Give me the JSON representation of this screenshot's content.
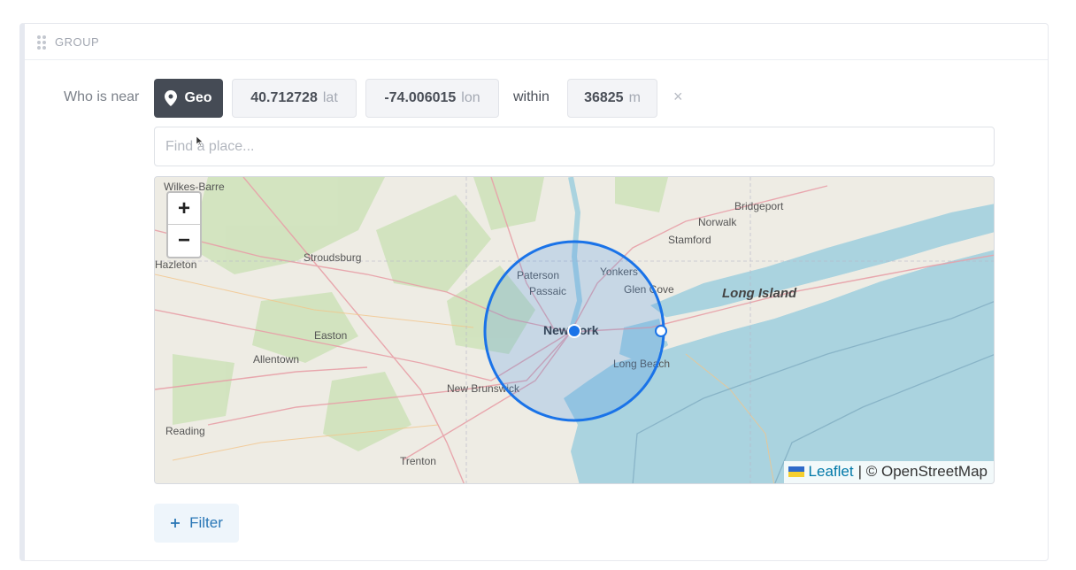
{
  "group": {
    "title": "GROUP"
  },
  "condition": {
    "label": "Who is near",
    "type_label": "Geo",
    "lat_value": "40.712728",
    "lat_unit": "lat",
    "lon_value": "-74.006015",
    "lon_unit": "lon",
    "within_label": "within",
    "radius_value": "36825",
    "radius_unit": "m",
    "remove_label": "×"
  },
  "search": {
    "placeholder": "Find a place..."
  },
  "map": {
    "zoom_in": "+",
    "zoom_out": "−",
    "attribution_link": "Leaflet",
    "attribution_text": "| © OpenStreetMap",
    "labels": {
      "wilkes_barre": "Wilkes-Barre",
      "hazleton": "Hazleton",
      "stroudsburg": "Stroudsburg",
      "easton": "Easton",
      "allentown": "Allentown",
      "reading": "Reading",
      "trenton": "Trenton",
      "new_brunswick": "New Brunswick",
      "paterson": "Paterson",
      "passaic": "Passaic",
      "yonkers": "Yonkers",
      "glen_cove": "Glen Cove",
      "new_york": "New York",
      "long_beach": "Long Beach",
      "stamford": "Stamford",
      "norwalk": "Norwalk",
      "bridgeport": "Bridgeport",
      "long_island": "Long Island"
    },
    "colors": {
      "circle": "#1a73e8",
      "water": "#aad3df",
      "land": "#eeece4",
      "forest": "#c8e0b4"
    }
  },
  "filter_button": {
    "label": "Filter",
    "icon": "plus-icon"
  }
}
